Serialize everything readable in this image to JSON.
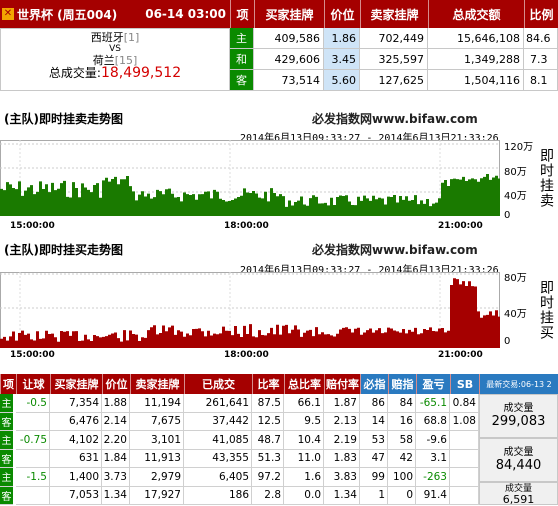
{
  "top": {
    "league": "世界杯 (周五004)",
    "time": "06-14 03:00",
    "headers": [
      "项",
      "买家挂牌",
      "价位",
      "卖家挂牌",
      "总成交额",
      "比例"
    ],
    "home": "西班牙",
    "home_rank": "[1]",
    "vs": "VS",
    "away": "荷兰",
    "away_rank": "[15]",
    "total_label": "总成交量:",
    "total_value": "18,499,512",
    "rows": [
      {
        "label": "主",
        "buy": "409,586",
        "price": "1.86",
        "sell": "702,449",
        "total": "15,646,108",
        "ratio": "84.6"
      },
      {
        "label": "和",
        "buy": "429,606",
        "price": "3.45",
        "sell": "325,597",
        "total": "1,349,288",
        "ratio": "7.3"
      },
      {
        "label": "客",
        "buy": "73,514",
        "price": "5.60",
        "sell": "127,625",
        "total": "1,504,116",
        "ratio": "8.1"
      }
    ]
  },
  "chart1": {
    "title": "(主队)即时挂卖走势图",
    "brand": "必发指数网www.bifaw.com",
    "range": "2014年6月13日09:33:27 - 2014年6月13日21:33:26",
    "yticks": [
      "120万",
      "80万",
      "40万",
      "0"
    ],
    "xticks": [
      "15:00:00",
      "18:00:00",
      "21:00:00"
    ],
    "side_title": "即时挂卖",
    "color": "#1a7a00"
  },
  "chart2": {
    "title": "(主队)即时挂买走势图",
    "brand": "必发指数网www.bifaw.com",
    "range": "2014年6月13日09:33:27 - 2014年6月13日21:33:26",
    "yticks": [
      "80万",
      "40万",
      "0"
    ],
    "xticks": [
      "15:00:00",
      "18:00:00",
      "21:00:00"
    ],
    "side_title": "即时挂买",
    "color": "#a50000"
  },
  "bottom": {
    "headers": [
      "项",
      "让球",
      "买家挂牌",
      "价位",
      "卖家挂牌",
      "已成交",
      "比率",
      "总比率",
      "赔付率",
      "必指",
      "赔指",
      "盈亏",
      "SB",
      "最新交易:06-13 2"
    ],
    "rows": [
      {
        "side": "主",
        "handicap": "-0.5",
        "buy": "7,354",
        "price": "1.88",
        "sell": "11,194",
        "done": "261,641",
        "rate": "87.5",
        "total_rate": "66.1",
        "payout": "1.87",
        "bz": "86",
        "pz": "84",
        "pl": "-65.1",
        "sb": "0.84",
        "pl_color": "grn"
      },
      {
        "side": "客",
        "handicap": "",
        "buy": "6,476",
        "price": "2.14",
        "sell": "7,675",
        "done": "37,442",
        "rate": "12.5",
        "total_rate": "9.5",
        "payout": "2.13",
        "bz": "14",
        "pz": "16",
        "pl": "68.8",
        "sb": "1.08",
        "pl_color": ""
      },
      {
        "side": "主",
        "handicap": "-0.75",
        "buy": "4,102",
        "price": "2.20",
        "sell": "3,101",
        "done": "41,085",
        "rate": "48.7",
        "total_rate": "10.4",
        "payout": "2.19",
        "bz": "53",
        "pz": "58",
        "pl": "-9.6",
        "sb": "",
        "pl_color": ""
      },
      {
        "side": "客",
        "handicap": "",
        "buy": "631",
        "price": "1.84",
        "sell": "11,913",
        "done": "43,355",
        "rate": "51.3",
        "total_rate": "11.0",
        "payout": "1.83",
        "bz": "47",
        "pz": "42",
        "pl": "3.1",
        "sb": "",
        "pl_color": ""
      },
      {
        "side": "主",
        "handicap": "-1.5",
        "buy": "1,400",
        "price": "3.73",
        "sell": "2,979",
        "done": "6,405",
        "rate": "97.2",
        "total_rate": "1.6",
        "payout": "3.83",
        "bz": "99",
        "pz": "100",
        "pl": "-263",
        "sb": "",
        "pl_color": "grn"
      },
      {
        "side": "客",
        "handicap": "",
        "buy": "7,053",
        "price": "1.34",
        "sell": "17,927",
        "done": "186",
        "rate": "2.8",
        "total_rate": "0.0",
        "payout": "1.34",
        "bz": "1",
        "pz": "0",
        "pl": "91.4",
        "sb": "",
        "pl_color": ""
      }
    ],
    "volumes": [
      {
        "label": "成交量",
        "value": "299,083"
      },
      {
        "label": "成交量",
        "value": "84,440"
      },
      {
        "label": "成交量",
        "value": "6,591"
      }
    ]
  }
}
